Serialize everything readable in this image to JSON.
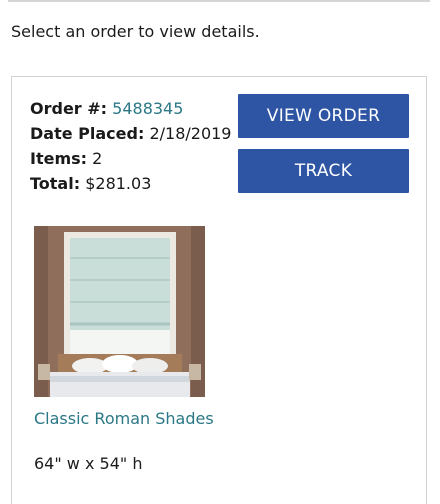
{
  "intro_text": "Select an order to view details.",
  "order": {
    "number_label": "Order #:",
    "number_value": "5488345",
    "date_label": "Date Placed:",
    "date_value": "2/18/2019",
    "items_label": "Items:",
    "items_value": "2",
    "total_label": "Total:",
    "total_value": "$281.03"
  },
  "buttons": {
    "view_order": "VIEW ORDER",
    "track": "TRACK"
  },
  "product": {
    "name": "Classic Roman Shades",
    "size": "64\" w x 54\" h",
    "image_icon": "roman-shade-photo"
  },
  "colors": {
    "button_bg": "#2d55a3",
    "link": "#2b7886"
  }
}
